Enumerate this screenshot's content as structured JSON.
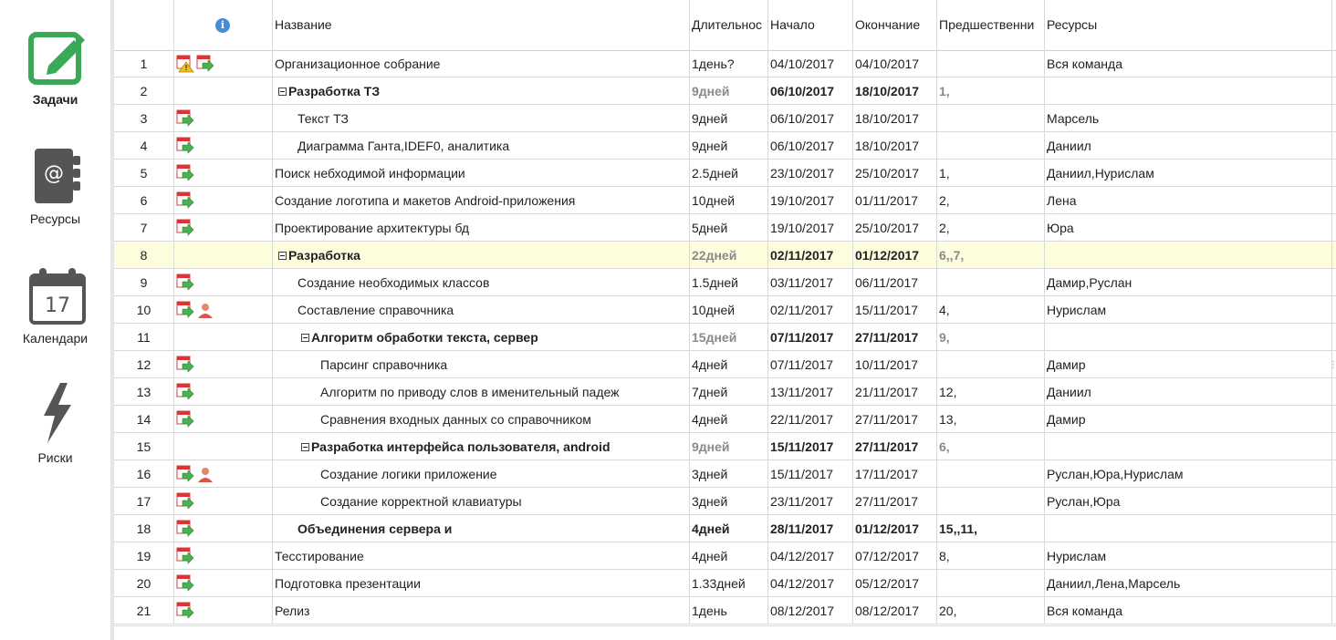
{
  "sidebar": {
    "items": [
      {
        "label": "Задачи",
        "icon": "edit-square-icon",
        "active": true
      },
      {
        "label": "Ресурсы",
        "icon": "address-book-icon",
        "active": false
      },
      {
        "label": "Календари",
        "icon": "calendar-icon",
        "active": false,
        "calendar_day": "17"
      },
      {
        "label": "Риски",
        "icon": "lightning-icon",
        "active": false
      }
    ]
  },
  "colors": {
    "accent_green": "#3aa856",
    "selected_row": "#fdfcdc",
    "summary_gray": "#8a8a8a"
  },
  "table": {
    "columns": {
      "info": "i",
      "name": "Название",
      "duration": "Длительнос",
      "start": "Начало",
      "end": "Окончание",
      "predecessors": "Предшественни",
      "resources": "Ресурсы"
    },
    "rows": [
      {
        "num": "1",
        "indicators": [
          "warning-task-icon",
          "task-icon"
        ],
        "name": "Организационное собрание",
        "duration": "1день?",
        "start": "04/10/2017",
        "end": "04/10/2017",
        "pred": "",
        "res": "Вся команда",
        "level": 0,
        "summary": false,
        "bold": false
      },
      {
        "num": "2",
        "indicators": [],
        "name": "Разработка ТЗ",
        "duration": "9дней",
        "start": "06/10/2017",
        "end": "18/10/2017",
        "pred": "1,",
        "res": "",
        "level": 0,
        "summary": true,
        "bold": true
      },
      {
        "num": "3",
        "indicators": [
          "task-icon"
        ],
        "name": "Текст ТЗ",
        "duration": "9дней",
        "start": "06/10/2017",
        "end": "18/10/2017",
        "pred": "",
        "res": "Марсель",
        "level": 1,
        "summary": false,
        "bold": false
      },
      {
        "num": "4",
        "indicators": [
          "task-icon"
        ],
        "name": "Диаграмма Ганта,IDEF0, аналитика",
        "duration": "9дней",
        "start": "06/10/2017",
        "end": "18/10/2017",
        "pred": "",
        "res": "Даниил",
        "level": 1,
        "summary": false,
        "bold": false
      },
      {
        "num": "5",
        "indicators": [
          "task-icon"
        ],
        "name": "Поиск небходимой информации",
        "duration": "2.5дней",
        "start": "23/10/2017",
        "end": "25/10/2017",
        "pred": "1,",
        "res": "Даниил,Нурислам",
        "level": 0,
        "summary": false,
        "bold": false
      },
      {
        "num": "6",
        "indicators": [
          "task-icon"
        ],
        "name": "Создание логотипа и макетов Android-приложения",
        "duration": "10дней",
        "start": "19/10/2017",
        "end": "01/11/2017",
        "pred": "2,",
        "res": "Лена",
        "level": 0,
        "summary": false,
        "bold": false
      },
      {
        "num": "7",
        "indicators": [
          "task-icon"
        ],
        "name": "Проектирование архитектуры бд",
        "duration": "5дней",
        "start": "19/10/2017",
        "end": "25/10/2017",
        "pred": "2,",
        "res": "Юра",
        "level": 0,
        "summary": false,
        "bold": false
      },
      {
        "num": "8",
        "indicators": [],
        "name": "Разработка",
        "duration": "22дней",
        "start": "02/11/2017",
        "end": "01/12/2017",
        "pred": "6,,7,",
        "res": "",
        "level": 0,
        "summary": true,
        "bold": true,
        "selected": true
      },
      {
        "num": "9",
        "indicators": [
          "task-icon"
        ],
        "name": "Создание необходимых классов",
        "duration": "1.5дней",
        "start": "03/11/2017",
        "end": "06/11/2017",
        "pred": "",
        "res": "Дамир,Руслан",
        "level": 1,
        "summary": false,
        "bold": false
      },
      {
        "num": "10",
        "indicators": [
          "task-icon",
          "person-icon"
        ],
        "name": "Составление справочника",
        "duration": "10дней",
        "start": "02/11/2017",
        "end": "15/11/2017",
        "pred": "4,",
        "res": "Нурислам",
        "level": 1,
        "summary": false,
        "bold": false
      },
      {
        "num": "11",
        "indicators": [],
        "name": "Алгоритм обработки текста, сервер",
        "duration": "15дней",
        "start": "07/11/2017",
        "end": "27/11/2017",
        "pred": "9,",
        "res": "",
        "level": 1,
        "summary": true,
        "bold": true
      },
      {
        "num": "12",
        "indicators": [
          "task-icon"
        ],
        "name": "Парсинг справочника",
        "duration": "4дней",
        "start": "07/11/2017",
        "end": "10/11/2017",
        "pred": "",
        "res": "Дамир",
        "level": 2,
        "summary": false,
        "bold": false
      },
      {
        "num": "13",
        "indicators": [
          "task-icon"
        ],
        "name": "Алгоритм по приводу слов в именительный падеж",
        "duration": "7дней",
        "start": "13/11/2017",
        "end": "21/11/2017",
        "pred": "12,",
        "res": "Даниил",
        "level": 2,
        "summary": false,
        "bold": false
      },
      {
        "num": "14",
        "indicators": [
          "task-icon"
        ],
        "name": "Сравнения входных данных со справочником",
        "duration": "4дней",
        "start": "22/11/2017",
        "end": "27/11/2017",
        "pred": "13,",
        "res": "Дамир",
        "level": 2,
        "summary": false,
        "bold": false
      },
      {
        "num": "15",
        "indicators": [],
        "name": "Разработка интерфейса пользователя, android",
        "duration": "9дней",
        "start": "15/11/2017",
        "end": "27/11/2017",
        "pred": "6,",
        "res": "",
        "level": 1,
        "summary": true,
        "bold": true
      },
      {
        "num": "16",
        "indicators": [
          "task-icon",
          "person-icon"
        ],
        "name": "Создание логики приложение",
        "duration": "3дней",
        "start": "15/11/2017",
        "end": "17/11/2017",
        "pred": "",
        "res": "Руслан,Юра,Нурислам",
        "level": 2,
        "summary": false,
        "bold": false
      },
      {
        "num": "17",
        "indicators": [
          "task-icon"
        ],
        "name": "Создание корректной клавиатуры",
        "duration": "3дней",
        "start": "23/11/2017",
        "end": "27/11/2017",
        "pred": "",
        "res": "Руслан,Юра",
        "level": 2,
        "summary": false,
        "bold": false
      },
      {
        "num": "18",
        "indicators": [
          "task-icon"
        ],
        "name": "Объединения сервера и",
        "duration": "4дней",
        "start": "28/11/2017",
        "end": "01/12/2017",
        "pred": "15,,11,",
        "res": "",
        "level": 1,
        "summary": false,
        "bold": true,
        "noToggle": true
      },
      {
        "num": "19",
        "indicators": [
          "task-icon"
        ],
        "name": "Тесстирование",
        "duration": "4дней",
        "start": "04/12/2017",
        "end": "07/12/2017",
        "pred": "8,",
        "res": "Нурислам",
        "level": 0,
        "summary": false,
        "bold": false
      },
      {
        "num": "20",
        "indicators": [
          "task-icon"
        ],
        "name": "Подготовка презентации",
        "duration": "1.33дней",
        "start": "04/12/2017",
        "end": "05/12/2017",
        "pred": "",
        "res": "Даниил,Лена,Марсель",
        "level": 0,
        "summary": false,
        "bold": false
      },
      {
        "num": "21",
        "indicators": [
          "task-icon"
        ],
        "name": "Релиз",
        "duration": "1день",
        "start": "08/12/2017",
        "end": "08/12/2017",
        "pred": "20,",
        "res": "Вся команда",
        "level": 0,
        "summary": false,
        "bold": false
      }
    ]
  }
}
